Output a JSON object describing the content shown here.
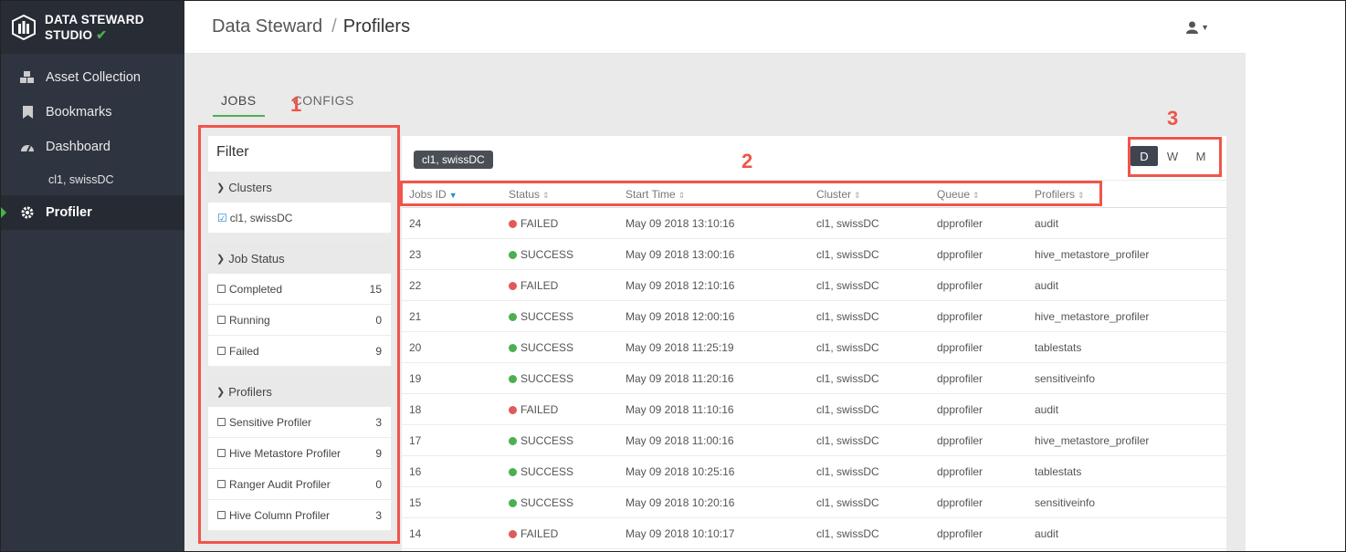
{
  "sidebar": {
    "brand_line1": "DATA STEWARD",
    "brand_line2": "STUDIO",
    "items": [
      {
        "label": "Asset Collection",
        "icon": "cubes-icon"
      },
      {
        "label": "Bookmarks",
        "icon": "bookmark-icon"
      },
      {
        "label": "Dashboard",
        "icon": "dashboard-icon"
      },
      {
        "label": "cl1, swissDC"
      },
      {
        "label": "Profiler",
        "icon": "gear-icon"
      }
    ]
  },
  "header": {
    "breadcrumb_parent": "Data Steward",
    "breadcrumb_sep": "/",
    "breadcrumb_current": "Profilers"
  },
  "tabs": [
    "JOBS",
    "CONFIGS"
  ],
  "filter": {
    "title": "Filter",
    "sections": [
      {
        "title": "Clusters",
        "items": [
          {
            "label": "cl1, swissDC",
            "count": "",
            "checked": true
          }
        ]
      },
      {
        "title": "Job Status",
        "items": [
          {
            "label": "Completed",
            "count": "15"
          },
          {
            "label": "Running",
            "count": "0"
          },
          {
            "label": "Failed",
            "count": "9"
          }
        ]
      },
      {
        "title": "Profilers",
        "items": [
          {
            "label": "Sensitive Profiler",
            "count": "3"
          },
          {
            "label": "Hive Metastore Profiler",
            "count": "9"
          },
          {
            "label": "Ranger Audit Profiler",
            "count": "0"
          },
          {
            "label": "Hive Column Profiler",
            "count": "3"
          }
        ]
      }
    ]
  },
  "panel": {
    "chip": "cl1, swissDC",
    "periods": [
      "D",
      "W",
      "M"
    ],
    "selected_period": "D"
  },
  "table": {
    "headers": [
      "Jobs ID",
      "Status",
      "Start Time",
      "Cluster",
      "Queue",
      "Profilers"
    ],
    "rows": [
      [
        "24",
        "FAILED",
        "May 09 2018 13:10:16",
        "cl1, swissDC",
        "dpprofiler",
        "audit"
      ],
      [
        "23",
        "SUCCESS",
        "May 09 2018 13:00:16",
        "cl1, swissDC",
        "dpprofiler",
        "hive_metastore_profiler"
      ],
      [
        "22",
        "FAILED",
        "May 09 2018 12:10:16",
        "cl1, swissDC",
        "dpprofiler",
        "audit"
      ],
      [
        "21",
        "SUCCESS",
        "May 09 2018 12:00:16",
        "cl1, swissDC",
        "dpprofiler",
        "hive_metastore_profiler"
      ],
      [
        "20",
        "SUCCESS",
        "May 09 2018 11:25:19",
        "cl1, swissDC",
        "dpprofiler",
        "tablestats"
      ],
      [
        "19",
        "SUCCESS",
        "May 09 2018 11:20:16",
        "cl1, swissDC",
        "dpprofiler",
        "sensitiveinfo"
      ],
      [
        "18",
        "FAILED",
        "May 09 2018 11:10:16",
        "cl1, swissDC",
        "dpprofiler",
        "audit"
      ],
      [
        "17",
        "SUCCESS",
        "May 09 2018 11:00:16",
        "cl1, swissDC",
        "dpprofiler",
        "hive_metastore_profiler"
      ],
      [
        "16",
        "SUCCESS",
        "May 09 2018 10:25:16",
        "cl1, swissDC",
        "dpprofiler",
        "tablestats"
      ],
      [
        "15",
        "SUCCESS",
        "May 09 2018 10:20:16",
        "cl1, swissDC",
        "dpprofiler",
        "sensitiveinfo"
      ],
      [
        "14",
        "FAILED",
        "May 09 2018 10:10:17",
        "cl1, swissDC",
        "dpprofiler",
        "audit"
      ]
    ]
  },
  "annotations": [
    "1",
    "2",
    "3"
  ],
  "colors": {
    "accent": "#4caf50",
    "failed": "#e05a5a",
    "success": "#4caf50",
    "annotation": "#f0554a",
    "sidebar": "#2f3540"
  }
}
